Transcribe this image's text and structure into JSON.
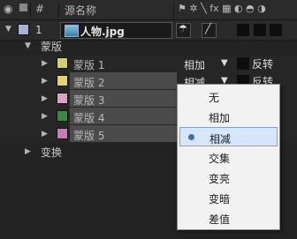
{
  "header": {
    "col_number": "#",
    "col_source_name": "源名称"
  },
  "layer": {
    "index": "1",
    "name": "人物.jpg"
  },
  "group": {
    "masks_label": "蒙版",
    "transform_label": "变换"
  },
  "masks": [
    {
      "name": "蒙版 1",
      "color": "#d8cf6a",
      "mode": "相加",
      "invert": "反转"
    },
    {
      "name": "蒙版 2",
      "color": "#e5d26c",
      "mode": "相减",
      "invert": "反转"
    },
    {
      "name": "蒙版 3",
      "color": "#d9a3c8"
    },
    {
      "name": "蒙版 4",
      "color": "#3b8a43"
    },
    {
      "name": "蒙版 5",
      "color": "#c77db5"
    }
  ],
  "layer_label_color": "#aab0d8",
  "menu": {
    "items": [
      "无",
      "相加",
      "相减",
      "交集",
      "变亮",
      "变暗",
      "差值"
    ],
    "selected": "相减"
  }
}
